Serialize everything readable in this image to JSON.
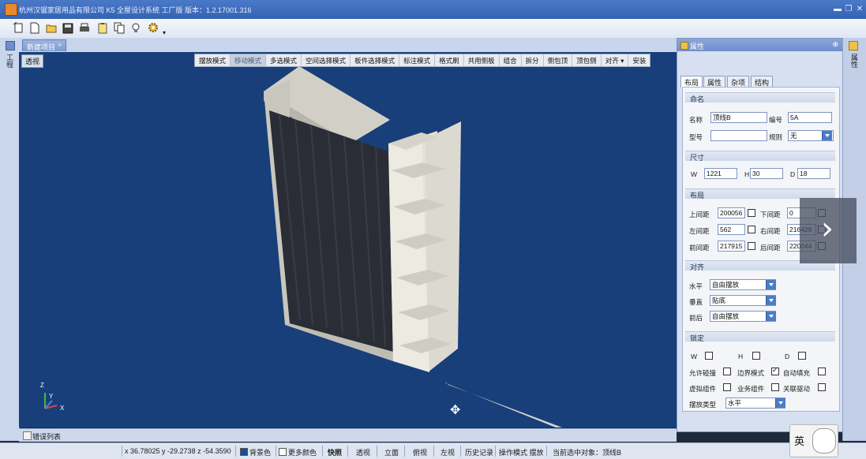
{
  "window": {
    "title": "杭州汉锯家居用品有限公司 K5 全屋设计系统 工厂版 版本：1.2.17001.316",
    "controls": [
      "minimize-icon",
      "restore-icon",
      "close-icon"
    ]
  },
  "toolbar": {
    "icons": [
      "new-icon",
      "blank-doc-icon",
      "open-folder-icon",
      "save-icon",
      "print-icon",
      "clipboard-icon",
      "copy-icon",
      "bulb-icon",
      "settings-gear-icon"
    ]
  },
  "left_strip": {
    "label": "工程"
  },
  "document_tab": {
    "label": "新建项目",
    "close": "×"
  },
  "viewport": {
    "view_label": "透视",
    "modes": [
      "摆放模式",
      "移动模式",
      "多选模式",
      "空间选择模式",
      "板件选择模式",
      "标注模式",
      "格式刷",
      "共用侧板",
      "组合",
      "拆分",
      "侧包顶",
      "顶包侧",
      "对齐",
      "安装"
    ],
    "active_mode": "移动模式",
    "axis": {
      "z": "Z",
      "y": "Y",
      "x": "X"
    },
    "background": "#183f7a"
  },
  "error_list": {
    "label": "错误列表"
  },
  "status": {
    "coords": "x 36.78025 y -29.2738 z -54.3590",
    "bg_color_label": "背景色",
    "more_color_label": "更多颜色",
    "buttons": [
      "快照",
      "透视",
      "立面",
      "俯视",
      "左视",
      "历史记录"
    ],
    "op_mode": "操作模式 摆放",
    "current_object": "当前选中对象：顶线B"
  },
  "panel": {
    "title": "属性",
    "tabs": [
      "布局",
      "属性",
      "杂项",
      "结构"
    ],
    "active_tab": "布局",
    "naming": {
      "section": "命名",
      "name_label": "名称",
      "name_value": "顶线B",
      "code_label": "编号",
      "code_value": "5A",
      "model_label": "型号",
      "model_value": "",
      "rule_label": "规则",
      "rule_value": "无"
    },
    "size": {
      "section": "尺寸",
      "w_label": "W",
      "w_value": "1221",
      "h_label": "H",
      "h_value": "30",
      "d_label": "D",
      "d_value": "18"
    },
    "layout": {
      "section": "布局",
      "top_label": "上间距",
      "top_value": "200056",
      "bottom_label": "下间距",
      "bottom_value": "0",
      "left_label": "左间距",
      "left_value": "562",
      "right_label": "右间距",
      "right_value": "216428",
      "front_label": "前间距",
      "front_value": "217915",
      "back_label": "后间距",
      "back_value": "220044"
    },
    "align": {
      "section": "对齐",
      "h_label": "水平",
      "h_value": "自由摆放",
      "v_label": "垂直",
      "v_value": "贴底",
      "fb_label": "前后",
      "fb_value": "自由摆放"
    },
    "lock": {
      "section": "锁定",
      "w": "W",
      "h": "H",
      "d": "D",
      "allow_collision": "允许碰撞",
      "edge_mode": "边界模式",
      "auto_fill": "自动填充",
      "virtual_group": "虚拟组件",
      "business_group": "业务组件",
      "link_drive": "关联驱动",
      "place_type_label": "摆放类型",
      "place_type_value": "水平"
    }
  },
  "right_strip": {
    "label": "属性"
  },
  "ime": {
    "label": "英"
  },
  "colors": {
    "accent": "#3463b3",
    "panel_bg": "#d6e0f0",
    "viewport_bg": "#183f7a"
  }
}
